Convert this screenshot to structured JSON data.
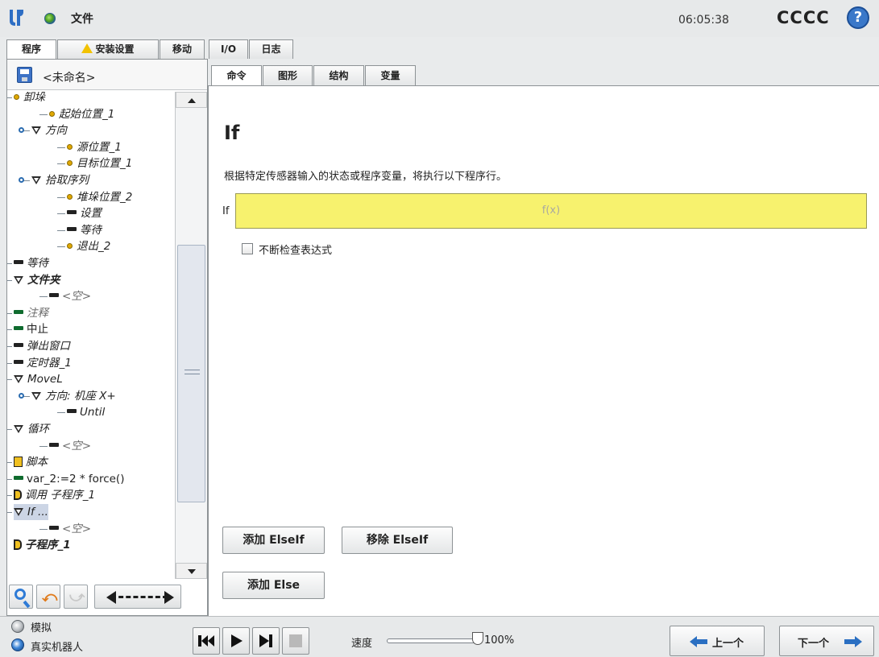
{
  "header": {
    "file_label": "文件",
    "clock": "06:05:38",
    "robot_name": "CCCC",
    "help_symbol": "?"
  },
  "top_tabs": [
    {
      "label": "程序",
      "active": true
    },
    {
      "label": "安装设置",
      "warning": true
    },
    {
      "label": "移动"
    },
    {
      "label": "I/O"
    },
    {
      "label": "日志"
    }
  ],
  "program": {
    "name": "<未命名>"
  },
  "tree": [
    {
      "label": "卸垛",
      "icon": "pallet-icon",
      "italic": true,
      "depth": 0
    },
    {
      "label": "起始位置_1",
      "icon": "waypoint-icon",
      "depth": 2
    },
    {
      "label": "方向",
      "icon": "folder-icon",
      "depth": 1
    },
    {
      "label": "源位置_1",
      "icon": "waypoint-icon",
      "depth": 3
    },
    {
      "label": "目标位置_1",
      "icon": "waypoint-icon",
      "depth": 3
    },
    {
      "label": "拾取序列",
      "icon": "folder-icon",
      "depth": 1
    },
    {
      "label": "堆垛位置_2",
      "icon": "waypoint-icon",
      "depth": 3
    },
    {
      "label": "设置",
      "icon": "command-icon",
      "depth": 3
    },
    {
      "label": "等待",
      "icon": "command-icon",
      "depth": 3
    },
    {
      "label": "退出_2",
      "icon": "waypoint-icon",
      "depth": 3
    },
    {
      "label": "等待",
      "icon": "command-icon",
      "depth": 0
    },
    {
      "label": "文件夹",
      "icon": "folder-icon",
      "depth": 0,
      "bold": true
    },
    {
      "label": "<空>",
      "icon": "command-icon",
      "depth": 2,
      "gray": true
    },
    {
      "label": "注释",
      "icon": "command-green-icon",
      "depth": 0,
      "gray": true
    },
    {
      "label": "中止",
      "icon": "command-green-icon",
      "depth": 0,
      "plain": true
    },
    {
      "label": "弹出窗口",
      "icon": "command-icon",
      "depth": 0
    },
    {
      "label": "定时器_1",
      "icon": "command-icon",
      "depth": 0
    },
    {
      "label": "MoveL",
      "icon": "folder-icon",
      "depth": 0
    },
    {
      "label": "方向: 机座 X+",
      "icon": "folder-icon",
      "depth": 1
    },
    {
      "label": "Until",
      "icon": "command-icon",
      "depth": 3
    },
    {
      "label": "循环",
      "icon": "folder-icon",
      "depth": 0
    },
    {
      "label": "<空>",
      "icon": "command-icon",
      "depth": 2,
      "gray": true
    },
    {
      "label": "脚本",
      "icon": "script-icon",
      "depth": 0
    },
    {
      "label": "var_2:=2 * force()",
      "icon": "command-green-icon",
      "depth": 0,
      "plain": true
    },
    {
      "label": "调用 子程序_1",
      "icon": "call-icon",
      "depth": 0
    },
    {
      "label": "If ...",
      "icon": "folder-icon",
      "depth": 0,
      "selected": true
    },
    {
      "label": "<空>",
      "icon": "command-icon",
      "depth": 2,
      "gray": true
    },
    {
      "label": "子程序_1",
      "icon": "call-icon",
      "depth": -1,
      "bold": true
    }
  ],
  "right_tabs": [
    {
      "label": "命令",
      "active": true
    },
    {
      "label": "图形"
    },
    {
      "label": "结构"
    },
    {
      "label": "变量"
    }
  ],
  "command": {
    "title": "If",
    "description": "根据特定传感器输入的状态或程序变量，将执行以下程序行。",
    "if_label": "If",
    "expression_placeholder": "f(x)",
    "check_label": "不断检查表达式",
    "check_checked": false,
    "add_elseif": "添加 ElseIf",
    "remove_elseif": "移除 ElseIf",
    "add_else": "添加 Else"
  },
  "footer": {
    "simulation_label": "模拟",
    "real_robot_label": "真实机器人",
    "real_robot_selected": true,
    "speed_label": "速度",
    "speed_value": "100%",
    "speed_fraction": 1.0,
    "prev_label": "上一个",
    "next_label": "下一个"
  },
  "colors": {
    "expression_bg": "#f7f26e",
    "selection_bg": "#ccd5e5",
    "accent_blue": "#3a78c9",
    "nav_arrow": "#2a6fc2"
  }
}
